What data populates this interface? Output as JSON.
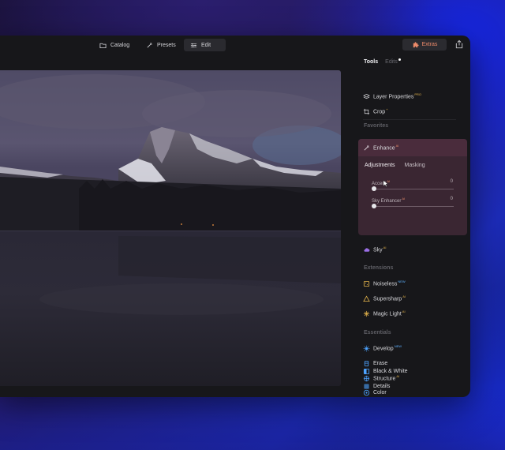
{
  "topbar": {
    "catalog": "Catalog",
    "presets": "Presets",
    "edit": "Edit",
    "extras": "Extras"
  },
  "panel": {
    "tabs": {
      "tools": "Tools",
      "edits": "Edits"
    },
    "layer_properties": "Layer Properties",
    "crop": "Crop",
    "favorites": "Favorites",
    "enhance": "Enhance",
    "subtabs": {
      "adjustments": "Adjustments",
      "masking": "Masking"
    },
    "sliders": [
      {
        "label": "Accent",
        "value": "0",
        "level": 0
      },
      {
        "label": "Sky Enhancer",
        "value": "0",
        "level": 0
      }
    ],
    "sky": "Sky",
    "extensions": "Extensions",
    "noiseless": "Noiseless",
    "supersharp": "Supersharp",
    "magic_light": "Magic Light",
    "essentials": "Essentials",
    "develop": "Develop",
    "erase": "Erase",
    "structure": "Structure",
    "color": "Color",
    "black_white": "Black & White",
    "details": "Details"
  },
  "colors": {
    "accent_extras": "#ec8a6a",
    "pro_badge": "#e3b34b",
    "new_badge": "#5fb2ff",
    "enhance_bg": "#3a2632"
  }
}
